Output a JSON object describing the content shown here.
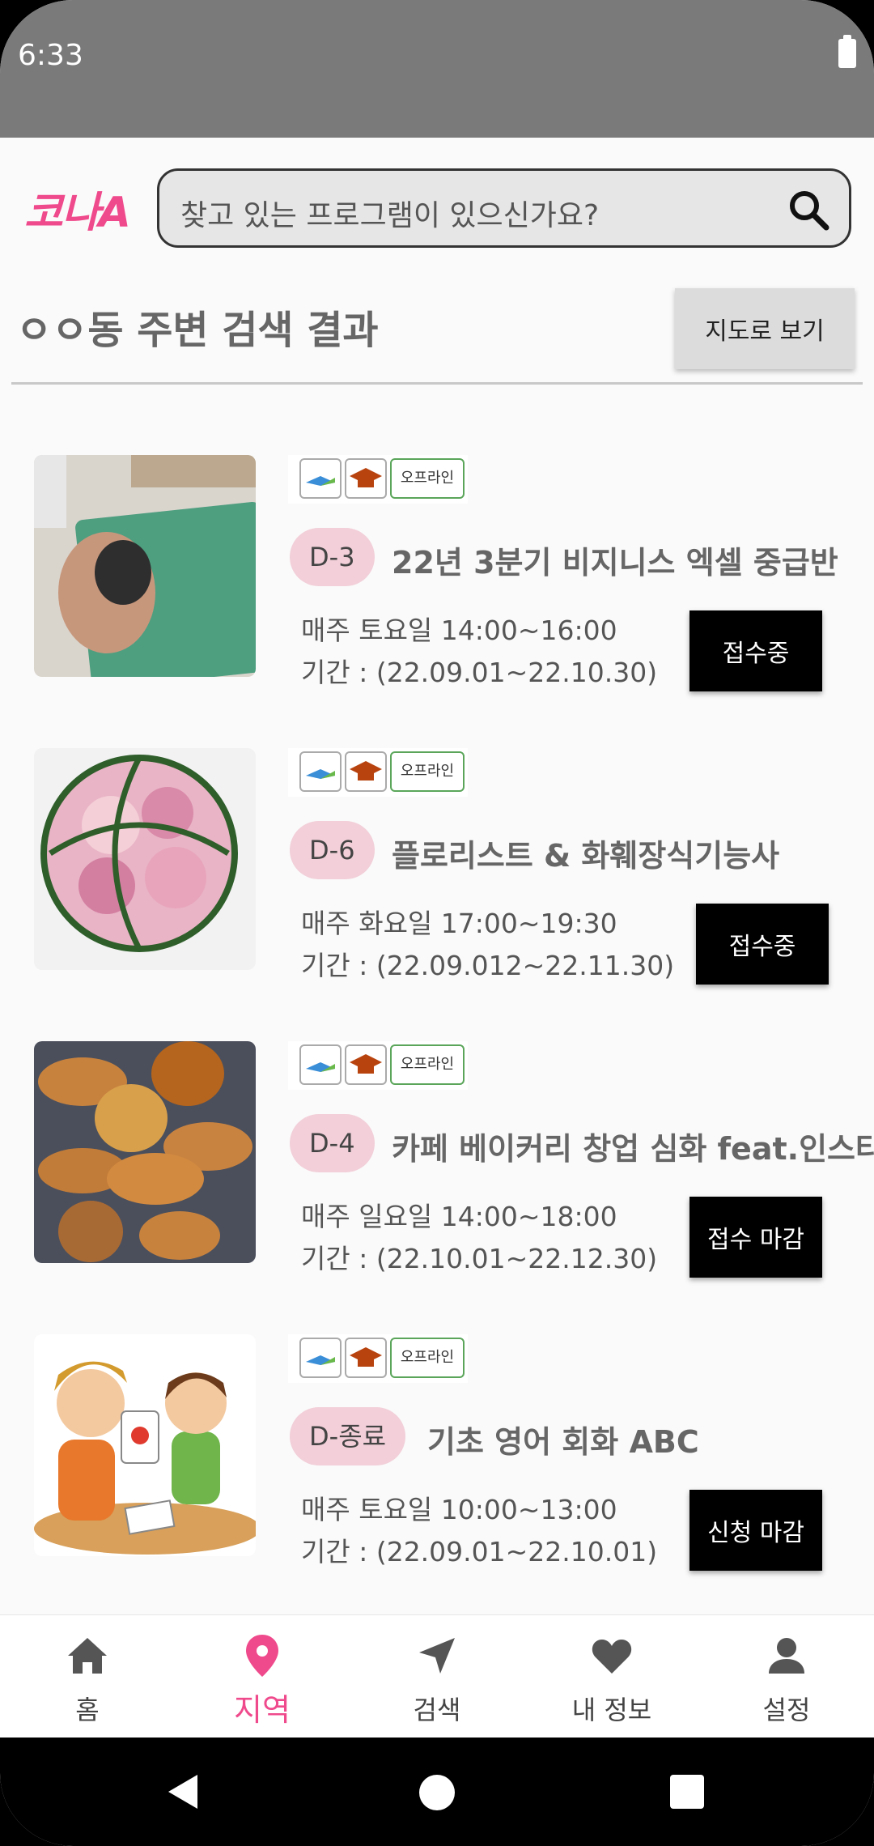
{
  "status_bar": {
    "time": "6:33"
  },
  "header": {
    "logo": "코나A",
    "search_placeholder": "찾고 있는 프로그램이 있으신가요?"
  },
  "results": {
    "title": "ㅇㅇ동 주변 검색 결과",
    "map_button": "지도로 보기"
  },
  "tags": {
    "offline": "오프라인"
  },
  "programs": [
    {
      "dday": "D-3",
      "title": "22년 3분기 비지니스 엑셀 중급반",
      "schedule": "매주 토요일 14:00~16:00",
      "period": "기간 : (22.09.01~22.10.30)",
      "status": "접수중",
      "thumb": "mouse-keyboard-photo"
    },
    {
      "dday": "D-6",
      "title": "플로리스트 & 화훼장식기능사",
      "schedule": "매주 화요일 17:00~19:30",
      "period": "기간 : (22.09.012~22.11.30)",
      "status": "접수중",
      "thumb": "flower-ball-photo"
    },
    {
      "dday": "D-4",
      "title": "카페 베이커리 창업 심화 feat.인스타",
      "schedule": "매주 일요일 14:00~18:00",
      "period": "기간 : (22.10.01~22.12.30)",
      "status": "접수 마감",
      "thumb": "bakery-photo"
    },
    {
      "dday": "D-종료",
      "title": "기초 영어 회화 ABC",
      "schedule": "매주 토요일 10:00~13:00",
      "period": "기간 : (22.09.01~22.10.01)",
      "status": "신청 마감",
      "thumb": "english-lesson-illustration"
    }
  ],
  "bottom_nav": [
    {
      "label": "홈",
      "icon": "home-icon"
    },
    {
      "label": "지역",
      "icon": "location-pin-icon",
      "active": true
    },
    {
      "label": "검색",
      "icon": "navigation-arrow-icon"
    },
    {
      "label": "내 정보",
      "icon": "heart-icon"
    },
    {
      "label": "설정",
      "icon": "person-icon"
    }
  ],
  "colors": {
    "accent": "#ef4a8c",
    "badge": "#f2cfd9",
    "status_bar": "#7a7a7a"
  }
}
